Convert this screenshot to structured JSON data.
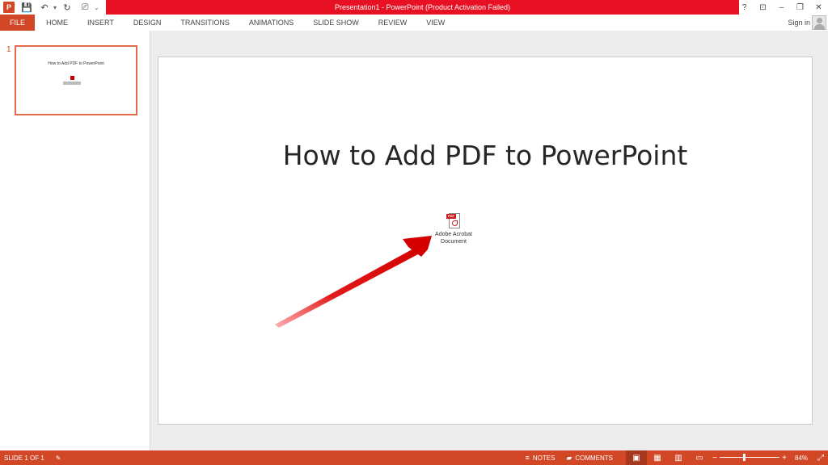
{
  "app": {
    "window_title": "Presentation1 -  PowerPoint (Product Activation Failed)",
    "logo_glyph": "P",
    "accent_color": "#d24726",
    "alert_color": "#e81123"
  },
  "qat": {
    "save_glyph": "💾",
    "undo_glyph": "↶",
    "redo_glyph": "↻",
    "present_glyph": "⎚",
    "customize_glyph": "⌄"
  },
  "window_controls": {
    "help": "?",
    "ribbon_display": "⊡",
    "minimize": "–",
    "restore": "❐",
    "close": "✕"
  },
  "ribbon": {
    "file_tab": "FILE",
    "tabs": [
      "HOME",
      "INSERT",
      "DESIGN",
      "TRANSITIONS",
      "ANIMATIONS",
      "SLIDE SHOW",
      "REVIEW",
      "VIEW"
    ],
    "sign_in": "Sign in"
  },
  "thumbnails": {
    "number": "1",
    "title": "How to Add PDF to PowerPoint"
  },
  "slide": {
    "title": "How to Add PDF to PowerPoint",
    "object_label_line1": "Adobe Acrobat",
    "object_label_line2": "Document",
    "pdf_tag": "PDF"
  },
  "statusbar": {
    "slide_info": "SLIDE 1 OF 1",
    "notes": "NOTES",
    "comments": "COMMENTS",
    "zoom_percent": "84%",
    "zoom_level": 0.84
  },
  "icons": {
    "notes_icon": "≡",
    "comments_icon": "▰",
    "normal_view_icon": "▣",
    "sorter_view_icon": "▦",
    "reading_view_icon": "▥",
    "slideshow_view_icon": "▭",
    "fit_icon": "⤢",
    "spell_icon": "✎"
  }
}
